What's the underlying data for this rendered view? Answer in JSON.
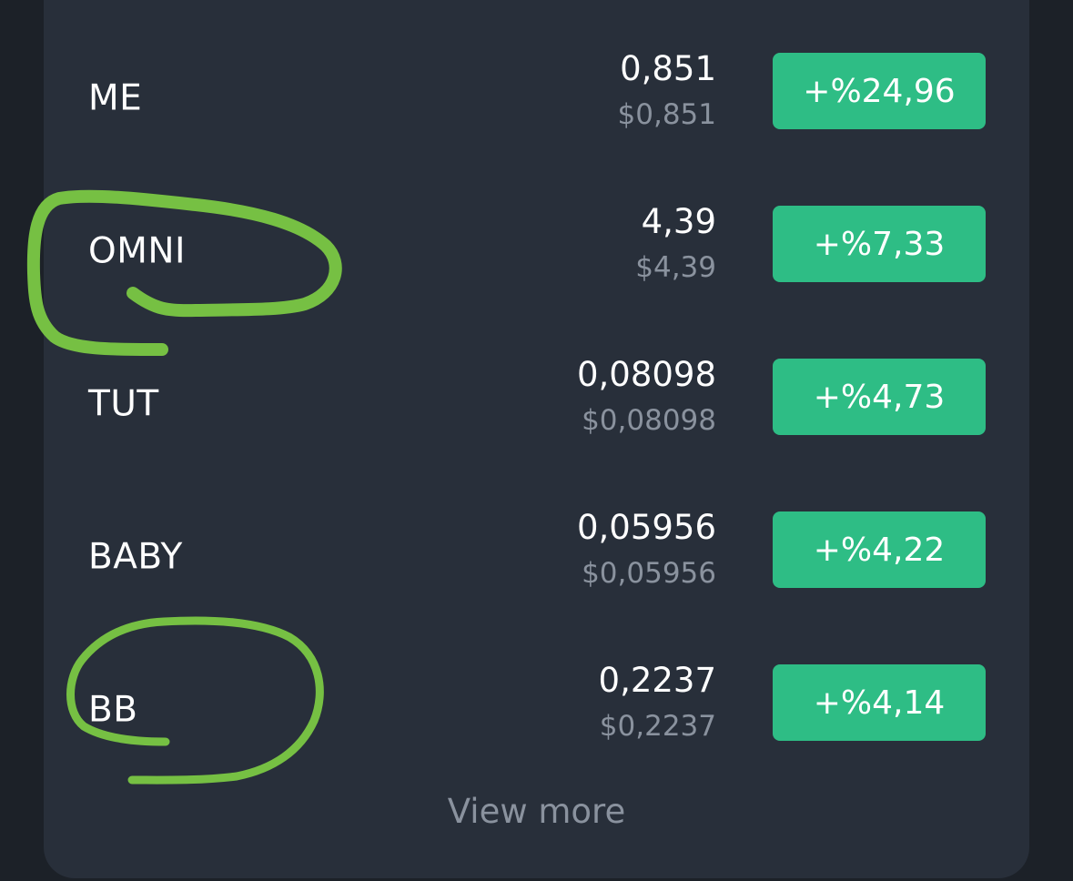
{
  "colors": {
    "background": "#1c2128",
    "card": "#282f3a",
    "positive": "#2ebd85",
    "text_primary": "#ffffff",
    "text_secondary": "#8a929e",
    "annotation": "#76c043"
  },
  "rows": [
    {
      "symbol": "ME",
      "price": "0,851",
      "usd": "$0,851",
      "change": "+%24,96"
    },
    {
      "symbol": "OMNI",
      "price": "4,39",
      "usd": "$4,39",
      "change": "+%7,33"
    },
    {
      "symbol": "TUT",
      "price": "0,08098",
      "usd": "$0,08098",
      "change": "+%4,73"
    },
    {
      "symbol": "BABY",
      "price": "0,05956",
      "usd": "$0,05956",
      "change": "+%4,22"
    },
    {
      "symbol": "BB",
      "price": "0,2237",
      "usd": "$0,2237",
      "change": "+%4,14"
    }
  ],
  "view_more_label": "View more"
}
